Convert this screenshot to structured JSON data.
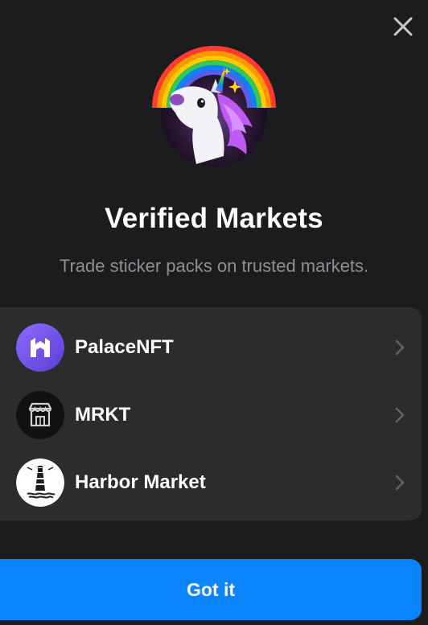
{
  "dialog": {
    "title": "Verified Markets",
    "subtitle": "Trade sticker packs on trusted markets.",
    "close_icon": "close-icon",
    "hero_icon": "unicorn-rainbow-icon"
  },
  "markets": [
    {
      "label": "PalaceNFT",
      "icon": "palace-logo-icon",
      "color": "#7b5cff"
    },
    {
      "label": "MRKT",
      "icon": "storefront-icon",
      "color": "#111111"
    },
    {
      "label": "Harbor Market",
      "icon": "lighthouse-icon",
      "color": "#ffffff"
    }
  ],
  "footer": {
    "button_label": "Got it"
  },
  "colors": {
    "background": "#1c1c1e",
    "card": "#2c2c2e",
    "accent": "#0a84ff",
    "muted_text": "#8e8e93"
  }
}
